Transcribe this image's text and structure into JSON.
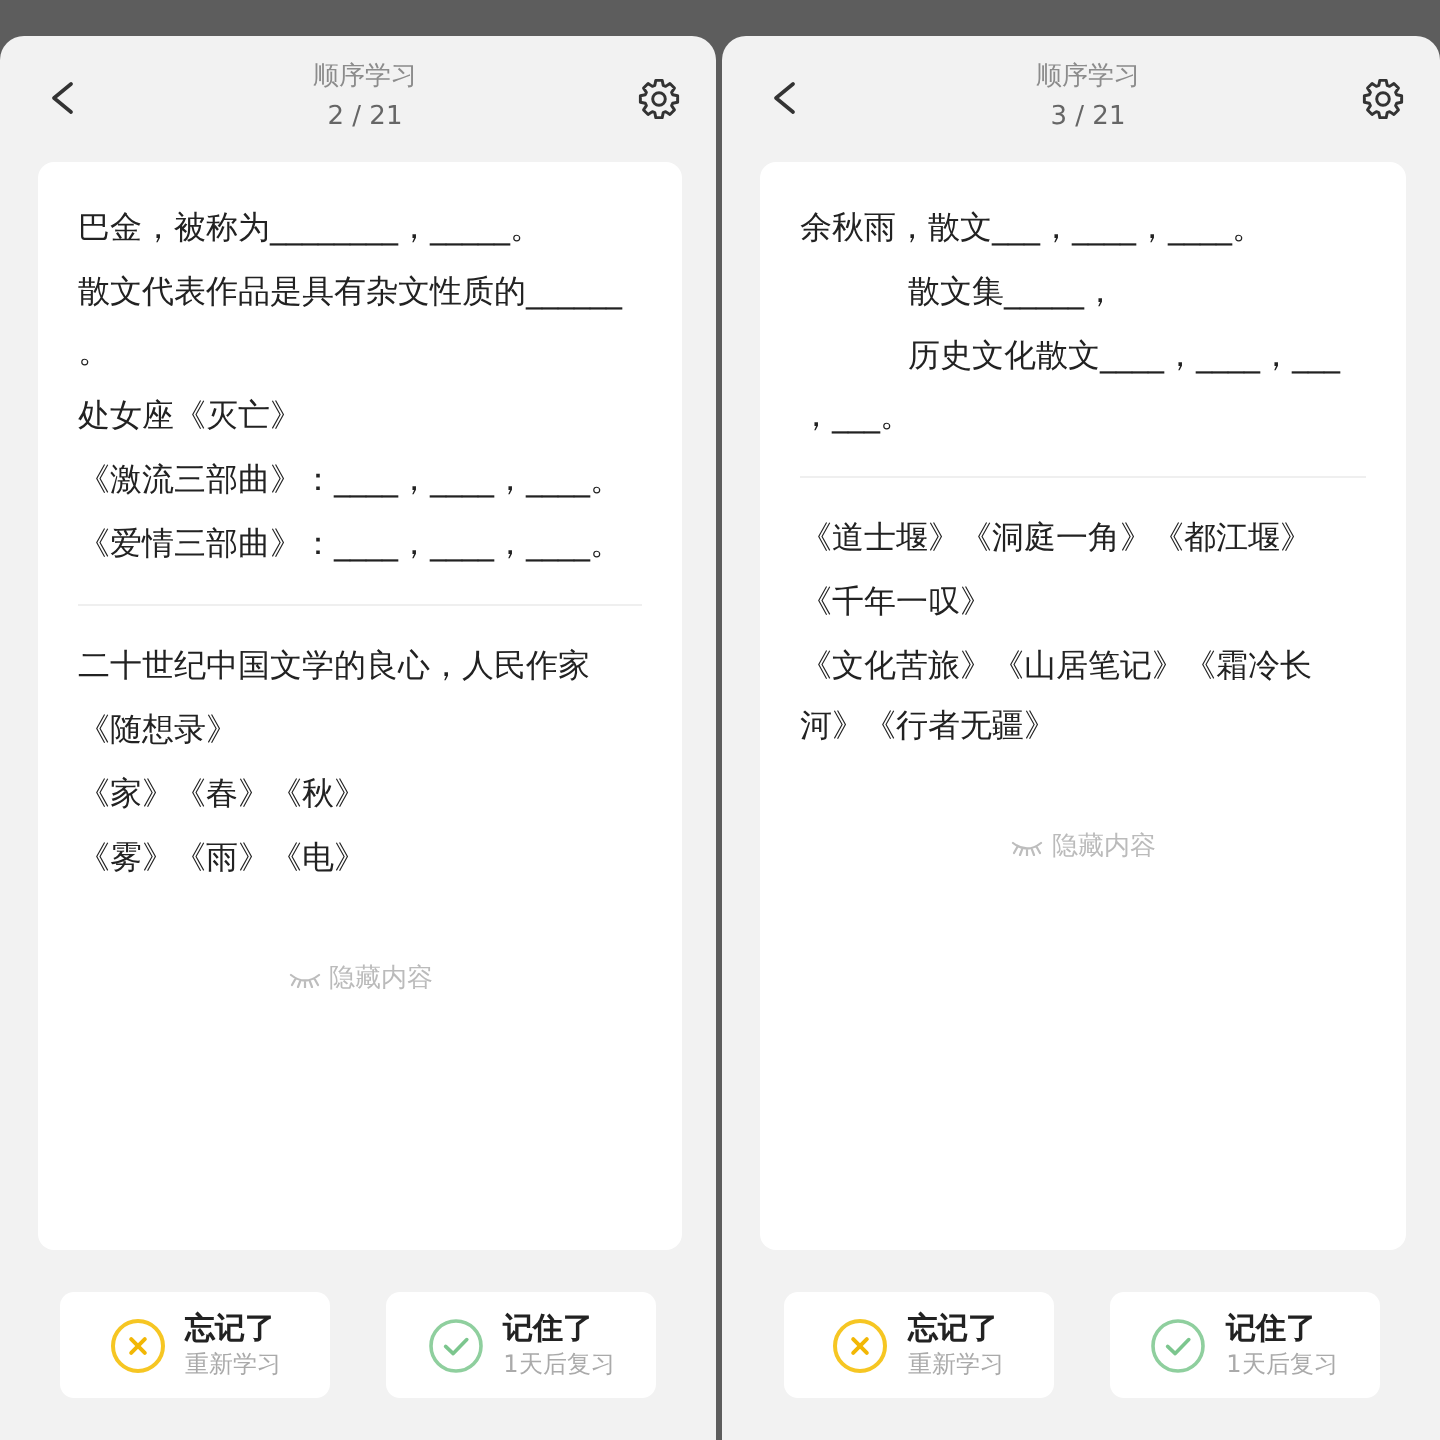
{
  "screens": [
    {
      "header": {
        "title": "顺序学习",
        "counter": "2 / 21"
      },
      "card": {
        "question": [
          {
            "lines": [
              "巴金，被称为________，_____。"
            ],
            "indented": false
          },
          {
            "lines": [
              "散文代表作品是具有杂文性质的______",
              "。"
            ],
            "indented": false
          },
          {
            "lines": [
              "处女座《灭亡》"
            ],
            "indented": false
          },
          {
            "lines": [
              "《激流三部曲》：____，____，____。"
            ],
            "indented": false
          },
          {
            "lines": [
              "《爱情三部曲》：____，____，____。"
            ],
            "indented": false
          }
        ],
        "answer": [
          {
            "lines": [
              "二十世纪中国文学的良心，人民作家"
            ],
            "indented": false
          },
          {
            "lines": [
              "《随想录》"
            ],
            "indented": false
          },
          {
            "lines": [
              "《家》《春》《秋》"
            ],
            "indented": false
          },
          {
            "lines": [
              "《雾》《雨》《电》"
            ],
            "indented": false
          }
        ],
        "hide_button": "隐藏内容"
      },
      "buttons": [
        {
          "kind": "forgot",
          "label": "忘记了",
          "hint": "重新学习"
        },
        {
          "kind": "remembered",
          "label": "记住了",
          "hint": "1天后复习"
        }
      ]
    },
    {
      "header": {
        "title": "顺序学习",
        "counter": "3 / 21"
      },
      "card": {
        "question": [
          {
            "lines": [
              "余秋雨，散文___，____，____。"
            ],
            "indented": false
          },
          {
            "lines": [
              "散文集_____，"
            ],
            "indented": true
          },
          {
            "lines": [
              "历史文化散文____，____，___",
              "，___。"
            ],
            "indented": true
          }
        ],
        "answer": [
          {
            "lines": [
              "《道士堰》《洞庭一角》《都江堰》"
            ],
            "indented": false
          },
          {
            "lines": [
              "《千年一叹》"
            ],
            "indented": false
          },
          {
            "lines": [
              "《文化苦旅》《山居笔记》《霜冷长",
              "河》《行者无疆》"
            ],
            "indented": false
          }
        ],
        "hide_button": "隐藏内容"
      },
      "buttons": [
        {
          "kind": "forgot",
          "label": "忘记了",
          "hint": "重新学习"
        },
        {
          "kind": "remembered",
          "label": "记住了",
          "hint": "1天后复习"
        }
      ]
    }
  ]
}
